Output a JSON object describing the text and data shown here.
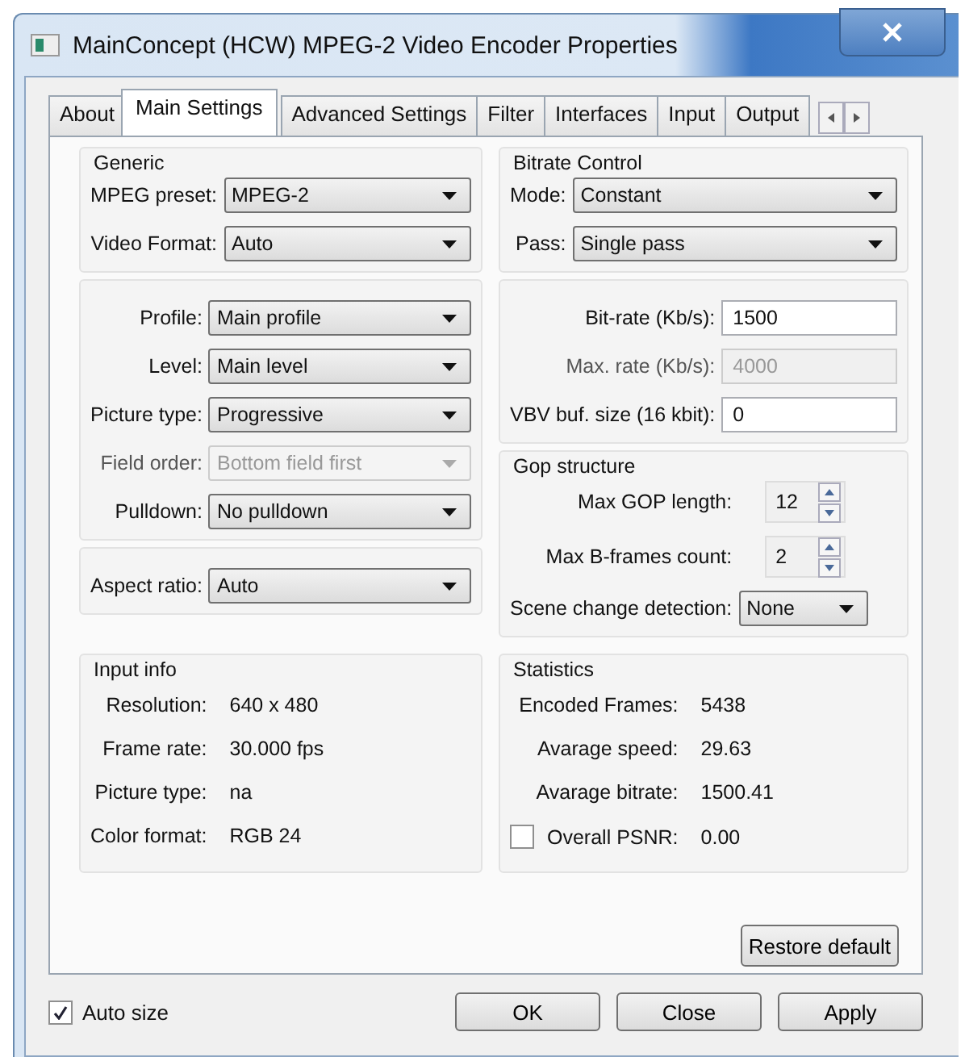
{
  "window": {
    "title": "MainConcept (HCW) MPEG-2 Video Encoder Properties"
  },
  "tabs": [
    {
      "label": "About",
      "selected": false
    },
    {
      "label": "Main Settings",
      "selected": true
    },
    {
      "label": "Advanced Settings",
      "selected": false
    },
    {
      "label": "Filter",
      "selected": false
    },
    {
      "label": "Interfaces",
      "selected": false
    },
    {
      "label": "Input",
      "selected": false
    },
    {
      "label": "Output",
      "selected": false
    }
  ],
  "columns": [
    {
      "sections": [
        {
          "title": "Generic",
          "rows": [
            {
              "kind": "select",
              "label": "MPEG preset:",
              "value": "MPEG-2",
              "disabled": false
            },
            {
              "kind": "select",
              "label": "Video Format:",
              "value": "Auto",
              "disabled": false
            }
          ]
        },
        {
          "rows": [
            {
              "kind": "select",
              "label": "Profile:",
              "value": "Main profile",
              "disabled": false
            },
            {
              "kind": "select",
              "label": "Level:",
              "value": "Main level",
              "disabled": false
            },
            {
              "kind": "select",
              "label": "Picture type:",
              "value": "Progressive",
              "disabled": false
            },
            {
              "kind": "select",
              "label": "Field order:",
              "value": "Bottom field first",
              "disabled": true
            },
            {
              "kind": "select",
              "label": "Pulldown:",
              "value": "No pulldown",
              "disabled": false
            }
          ]
        },
        {
          "rows": [
            {
              "kind": "select",
              "label": "Aspect ratio:",
              "value": "Auto",
              "disabled": false
            }
          ]
        }
      ]
    },
    {
      "sections": [
        {
          "title": "Bitrate Control",
          "rows": [
            {
              "kind": "select",
              "label": "Mode:",
              "value": "Constant",
              "disabled": false
            },
            {
              "kind": "select",
              "label": "Pass:",
              "value": "Single pass",
              "disabled": false
            }
          ]
        },
        {
          "rows": [
            {
              "kind": "text",
              "label": "Bit-rate (Kb/s):",
              "value": "1500",
              "disabled": false
            },
            {
              "kind": "text",
              "label": "Max. rate (Kb/s):",
              "value": "4000",
              "disabled": true
            },
            {
              "kind": "text",
              "label": "VBV buf. size (16 kbit):",
              "value": "0",
              "disabled": false
            }
          ]
        },
        {
          "title": "Gop structure",
          "rows": [
            {
              "kind": "spin",
              "label": "Max GOP length:",
              "value": "12",
              "disabled": false
            },
            {
              "kind": "spin",
              "label": "Max B-frames count:",
              "value": "2",
              "disabled": false
            },
            {
              "kind": "select",
              "label": "Scene change detection:",
              "value": "None",
              "disabled": false
            }
          ]
        }
      ]
    }
  ],
  "info_sections": [
    {
      "title": "Input info",
      "rows": [
        {
          "kind": "info",
          "label": "Resolution:",
          "value": "640 x 480"
        },
        {
          "kind": "info",
          "label": "Frame rate:",
          "value": "30.000 fps"
        },
        {
          "kind": "info",
          "label": "Picture type:",
          "value": "na"
        },
        {
          "kind": "info",
          "label": "Color format:",
          "value": "RGB 24"
        }
      ]
    },
    {
      "title": "Statistics",
      "rows": [
        {
          "kind": "info",
          "label": "Encoded Frames:",
          "value": "5438"
        },
        {
          "kind": "info",
          "label": "Avarage speed:",
          "value": "29.63"
        },
        {
          "kind": "info",
          "label": "Avarage bitrate:",
          "value": "1500.41"
        },
        {
          "kind": "check",
          "label": "Overall PSNR:",
          "value": "0.00",
          "checked": false
        }
      ]
    }
  ],
  "restore_button": "Restore default",
  "auto_size": {
    "label": "Auto size",
    "checked": true
  },
  "buttons": [
    "OK",
    "Close",
    "Apply"
  ]
}
